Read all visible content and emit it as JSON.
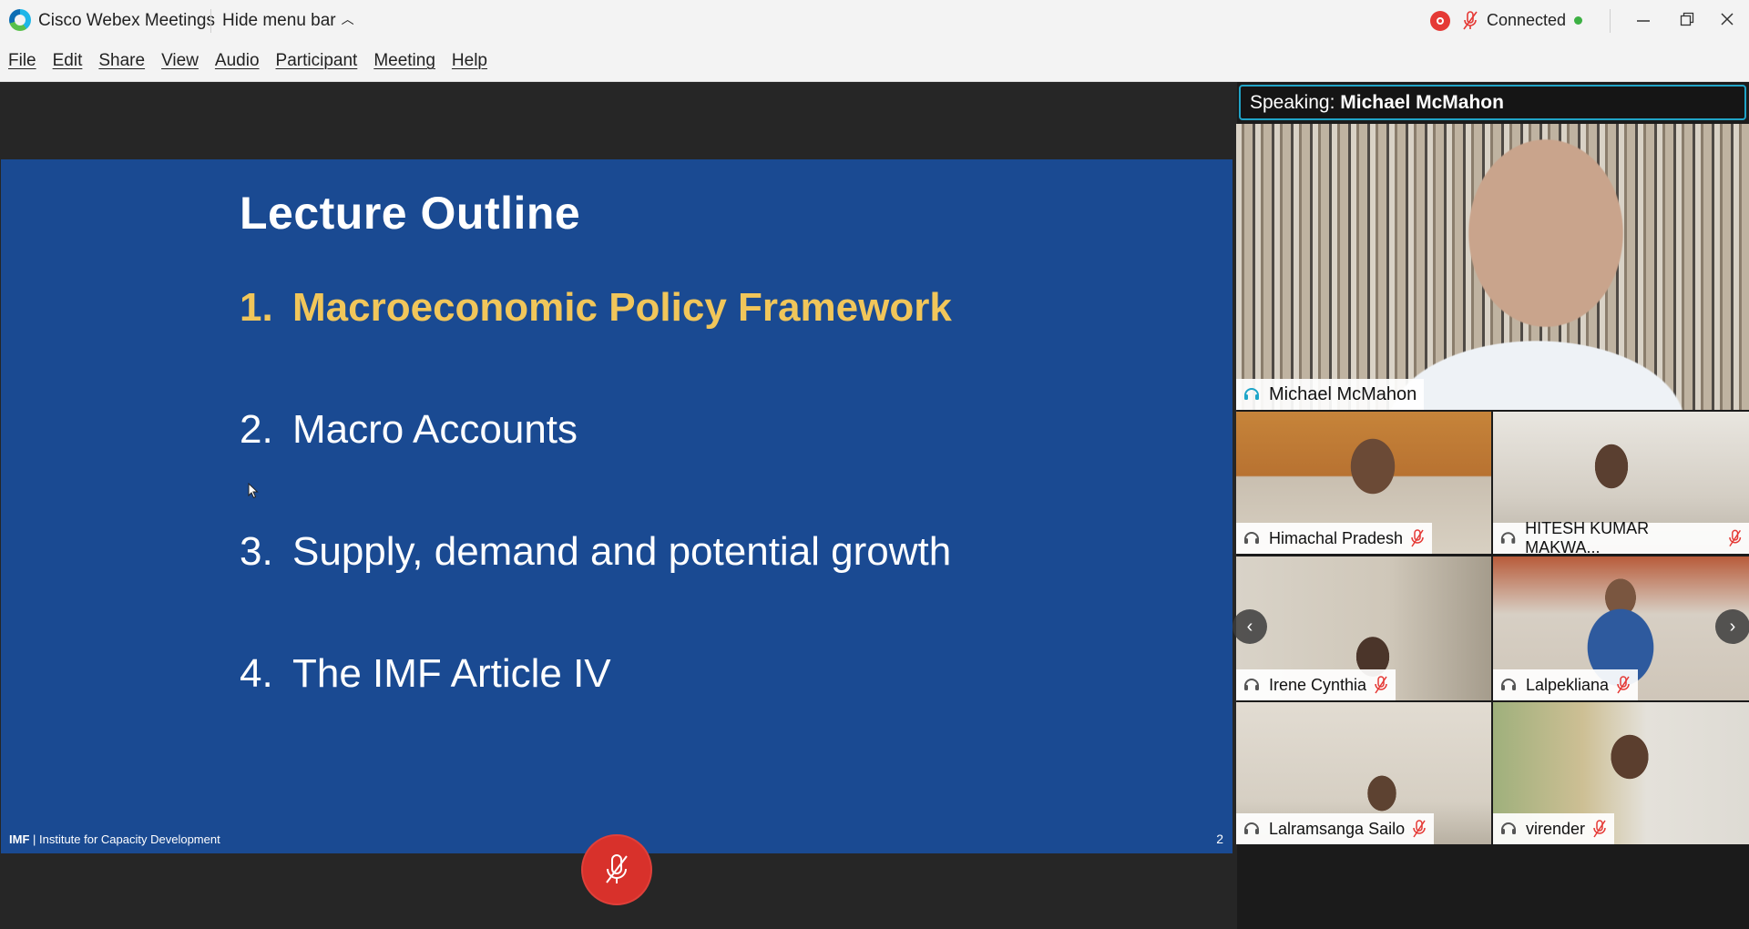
{
  "titlebar": {
    "app_title": "Cisco Webex Meetings",
    "hide_menu_label": "Hide menu bar",
    "status": "Connected",
    "status_color": "#3cb043",
    "recording_color": "#e53935"
  },
  "menubar": {
    "items": [
      "File",
      "Edit",
      "Share",
      "View",
      "Audio",
      "Participant",
      "Meeting",
      "Help"
    ]
  },
  "slide": {
    "title": "Lecture Outline",
    "items": [
      {
        "num": "1.",
        "text": "Macroeconomic Policy Framework",
        "active": true
      },
      {
        "num": "2.",
        "text": "Macro Accounts",
        "active": false
      },
      {
        "num": "3.",
        "text": "Supply, demand and potential growth",
        "active": false
      },
      {
        "num": "4.",
        "text": "The IMF Article IV",
        "active": false
      }
    ],
    "footer_org": "IMF",
    "footer_text": " | Institute for Capacity Development",
    "page_number": "2",
    "background": "#1a4a92",
    "highlight_color": "#f1c65a"
  },
  "speaking": {
    "label": "Speaking:",
    "name": "Michael McMahon"
  },
  "active_speaker": {
    "name": "Michael McMahon"
  },
  "participants": [
    {
      "name": "Himachal Pradesh",
      "muted": true
    },
    {
      "name": "HITESH KUMAR MAKWA...",
      "muted": true
    },
    {
      "name": "Irene Cynthia",
      "muted": true
    },
    {
      "name": "Lalpekliana",
      "muted": true
    },
    {
      "name": "Lalramsanga Sailo",
      "muted": true
    },
    {
      "name": "virender",
      "muted": true
    }
  ],
  "icons": {
    "prev": "chevron-left-icon",
    "next": "chevron-right-icon",
    "mute": "microphone-muted-icon"
  }
}
